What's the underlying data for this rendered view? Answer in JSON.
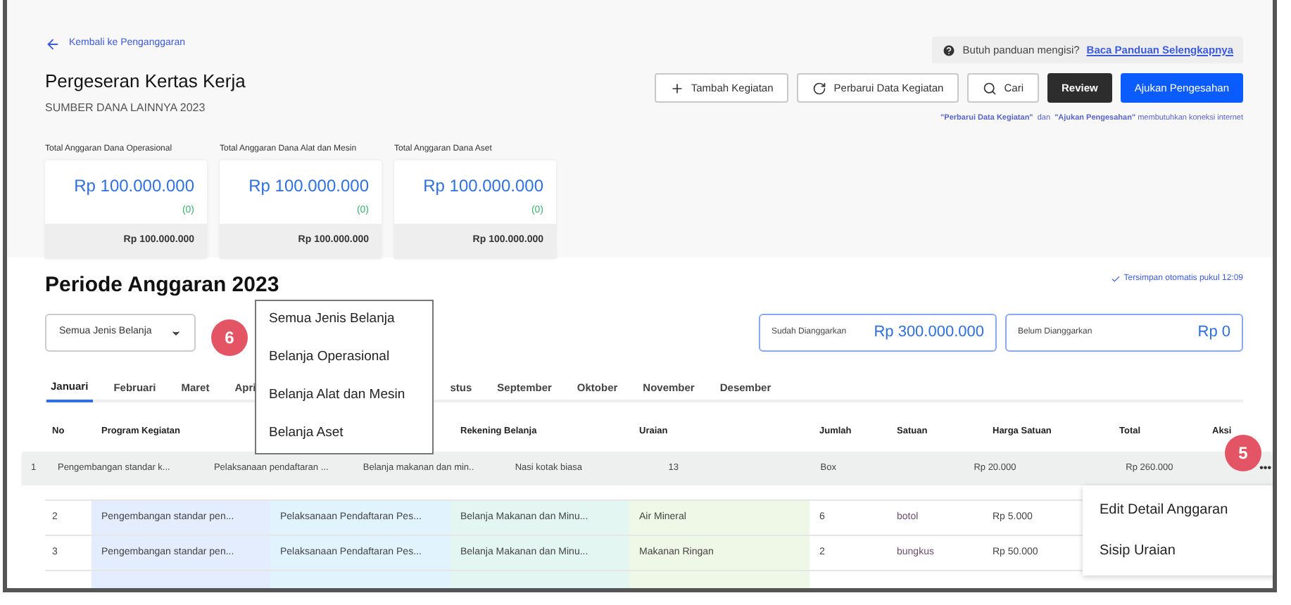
{
  "back_link": {
    "label": "Kembali ke Penganggaran"
  },
  "help": {
    "text": "Butuh panduan mengisi?",
    "link": "Baca Panduan Selengkapnya"
  },
  "page": {
    "title": "Pergeseran Kertas Kerja",
    "subtitle": "SUMBER DANA LAINNYA 2023"
  },
  "actions": [
    {
      "label": "Tambah Kegiatan",
      "kind": "outline"
    },
    {
      "label": "Perbarui Data Kegiatan",
      "kind": "outline"
    },
    {
      "label": "Cari",
      "kind": "outline"
    },
    {
      "label": "Review",
      "kind": "dark"
    },
    {
      "label": "Ajukan Pengesahan",
      "kind": "primary"
    }
  ],
  "note": "**\"Perbarui Data Kegiatan\"**  dan  **\"Ajukan Pengesahan\"** membutuhkan koneksi internet",
  "budget_cards": [
    {
      "label": "Total Anggaran Dana Operasional",
      "amount": "Rp 100.000.000",
      "change": "(0)",
      "total": "Rp 100.000.000"
    },
    {
      "label": "Total Anggaran Dana Alat dan Mesin",
      "amount": "Rp 100.000.000",
      "change": "(0)",
      "total": "Rp 100.000.000"
    },
    {
      "label": "Total Anggaran Dana Aset",
      "amount": "Rp 100.000.000",
      "change": "(0)",
      "total": "Rp 100.000.000"
    }
  ],
  "period": {
    "title": "Periode Anggaran 2023",
    "autosave": "Tersimpan otomatis pukul 12:09"
  },
  "filter": {
    "value": "Semua Jenis Belanja"
  },
  "summary": [
    {
      "label": "Sudah Dianggarkan",
      "amount": "Rp 300.000.000"
    },
    {
      "label": "Belum Dianggarkan",
      "amount": "Rp 0"
    }
  ],
  "tabs": [
    {
      "label": "Januari",
      "selected": true
    },
    {
      "label": "Februari",
      "selected": false
    },
    {
      "label": "Maret",
      "selected": false
    },
    {
      "label": "Apri",
      "selected": false
    },
    {
      "label": "stus",
      "selected": false
    },
    {
      "label": "September",
      "selected": false
    },
    {
      "label": "Oktober",
      "selected": false
    },
    {
      "label": "November",
      "selected": false
    },
    {
      "label": "Desember",
      "selected": false
    }
  ],
  "table": {
    "columns": [
      "No",
      "Program Kegiatan",
      "",
      "Rekening Belanja",
      "Uraian",
      "Jumlah",
      "Satuan",
      "Harga Satuan",
      "Total",
      "Aksi"
    ],
    "dragged_row": [
      "1",
      "Pengembangan standar k...",
      "Pelaksanaan pendaftaran ...",
      "Belanja makanan dan min..",
      "Nasi kotak biasa",
      "13",
      "Box",
      "Rp 20.000",
      "Rp 260.000"
    ],
    "row_action": "•••",
    "rows": [
      [
        "2",
        "Pengembangan standar pen...",
        "Pelaksanaan Pendaftaran Pes...",
        "Belanja Makanan dan Minu...",
        "Air Mineral",
        "6",
        "botol",
        "Rp 5.000"
      ],
      [
        "3",
        "Pengembangan standar pen...",
        "Pelaksanaan Pendaftaran Pes...",
        "Belanja Makanan dan Minu...",
        "Makanan Ringan",
        "2",
        "bungkus",
        "Rp 50.000"
      ]
    ]
  },
  "filter_options": [
    "Semua Jenis Belanja",
    "Belanja Operasional",
    "Belanja Alat dan Mesin",
    "Belanja Aset"
  ],
  "row_menu": [
    "Edit Detail Anggaran",
    "Sisip Uraian"
  ],
  "callouts": [
    "6",
    "5"
  ]
}
